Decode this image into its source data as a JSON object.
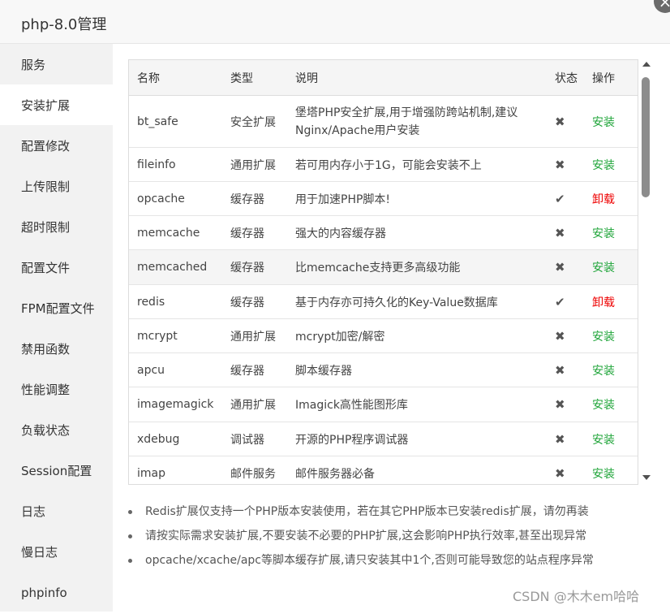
{
  "window": {
    "title": "php-8.0管理",
    "close_icon": "×"
  },
  "sidebar": {
    "items": [
      {
        "label": "服务",
        "active": false
      },
      {
        "label": "安装扩展",
        "active": true
      },
      {
        "label": "配置修改",
        "active": false
      },
      {
        "label": "上传限制",
        "active": false
      },
      {
        "label": "超时限制",
        "active": false
      },
      {
        "label": "配置文件",
        "active": false
      },
      {
        "label": "FPM配置文件",
        "active": false
      },
      {
        "label": "禁用函数",
        "active": false
      },
      {
        "label": "性能调整",
        "active": false
      },
      {
        "label": "负载状态",
        "active": false
      },
      {
        "label": "Session配置",
        "active": false
      },
      {
        "label": "日志",
        "active": false
      },
      {
        "label": "慢日志",
        "active": false
      },
      {
        "label": "phpinfo",
        "active": false
      }
    ]
  },
  "table": {
    "headers": {
      "name": "名称",
      "type": "类型",
      "desc": "说明",
      "status": "状态",
      "ops": "操作"
    },
    "rows": [
      {
        "name": "bt_safe",
        "type": "安全扩展",
        "desc": "堡塔PHP安全扩展,用于增强防跨站机制,建议Nginx/Apache用户安装",
        "status": "✖",
        "installed": false,
        "op": "安装"
      },
      {
        "name": "fileinfo",
        "type": "通用扩展",
        "desc": "若可用内存小于1G，可能会安装不上",
        "status": "✖",
        "installed": false,
        "op": "安装"
      },
      {
        "name": "opcache",
        "type": "缓存器",
        "desc": "用于加速PHP脚本!",
        "status": "✔",
        "installed": true,
        "op": "卸载"
      },
      {
        "name": "memcache",
        "type": "缓存器",
        "desc": "强大的内容缓存器",
        "status": "✖",
        "installed": false,
        "op": "安装"
      },
      {
        "name": "memcached",
        "type": "缓存器",
        "desc": "比memcache支持更多高级功能",
        "status": "✖",
        "installed": false,
        "op": "安装",
        "highlight": true
      },
      {
        "name": "redis",
        "type": "缓存器",
        "desc": "基于内存亦可持久化的Key-Value数据库",
        "status": "✔",
        "installed": true,
        "op": "卸载"
      },
      {
        "name": "mcrypt",
        "type": "通用扩展",
        "desc": "mcrypt加密/解密",
        "status": "✖",
        "installed": false,
        "op": "安装"
      },
      {
        "name": "apcu",
        "type": "缓存器",
        "desc": "脚本缓存器",
        "status": "✖",
        "installed": false,
        "op": "安装"
      },
      {
        "name": "imagemagick",
        "type": "通用扩展",
        "desc": "Imagick高性能图形库",
        "status": "✖",
        "installed": false,
        "op": "安装"
      },
      {
        "name": "xdebug",
        "type": "调试器",
        "desc": "开源的PHP程序调试器",
        "status": "✖",
        "installed": false,
        "op": "安装"
      },
      {
        "name": "imap",
        "type": "邮件服务",
        "desc": "邮件服务器必备",
        "status": "✖",
        "installed": false,
        "op": "安装"
      }
    ]
  },
  "notes": [
    "Redis扩展仅支持一个PHP版本安装使用，若在其它PHP版本已安装redis扩展，请勿再装",
    "请按实际需求安装扩展,不要安装不必要的PHP扩展,这会影响PHP执行效率,甚至出现异常",
    "opcache/xcache/apc等脚本缓存扩展,请只安装其中1个,否则可能导致您的站点程序异常"
  ],
  "watermark": "CSDN @木木em哈哈",
  "colors": {
    "install": "#20a53a",
    "uninstall": "#ee0000",
    "sidebar_bg": "#f2f2f2"
  }
}
